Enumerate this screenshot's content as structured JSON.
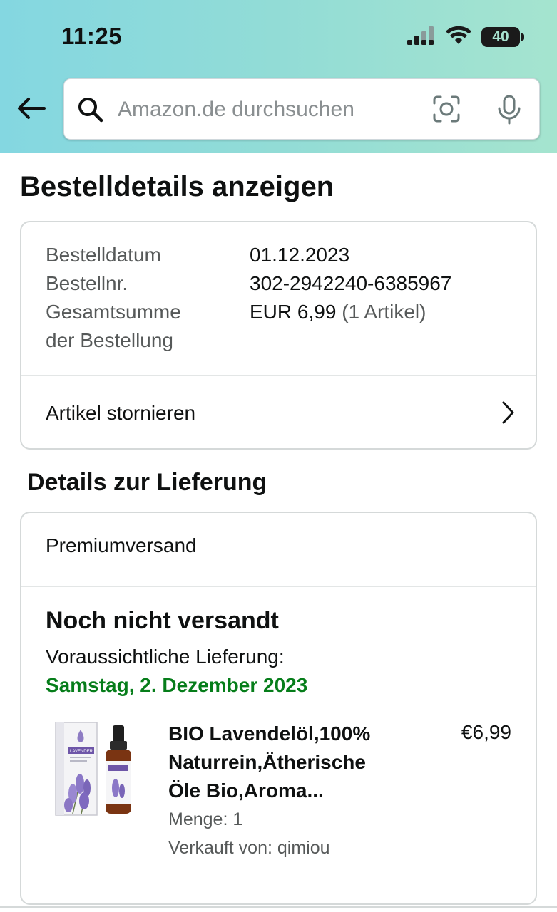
{
  "status_bar": {
    "time": "11:25",
    "battery": "40"
  },
  "search": {
    "placeholder": "Amazon.de durchsuchen"
  },
  "icons": {
    "back": "arrow-left-icon",
    "search": "magnifier-icon",
    "camera": "camera-scan-icon",
    "mic": "microphone-icon",
    "chevron": "chevron-right-icon"
  },
  "page": {
    "title": "Bestelldetails anzeigen"
  },
  "order": {
    "date_label": "Bestelldatum",
    "date_value": "01.12.2023",
    "number_label": "Bestellnr.",
    "number_value": "302-2942240-6385967",
    "total_label_line1": "Gesamtsumme",
    "total_label_line2": "der Bestellung",
    "total_value": "EUR 6,99",
    "total_count": "(1 Artikel)",
    "cancel_label": "Artikel stornieren"
  },
  "delivery": {
    "section_title": "Details zur Lieferung",
    "shipping_method": "Premiumversand",
    "status": "Noch nicht versandt",
    "expected_label": "Voraussichtliche Lieferung:",
    "expected_date": "Samstag, 2. Dezember 2023"
  },
  "product": {
    "title_line1": "BIO Lavendelöl,100%",
    "title_line2": "Naturrein,Ätherische",
    "title_line3": "Öle Bio,Aroma...",
    "price": "€6,99",
    "quantity": "Menge: 1",
    "seller": "Verkauft von: qimiou",
    "image_box_label": "LAVENDER"
  },
  "colors": {
    "header_gradient_start": "#84d7e1",
    "header_gradient_end": "#a5e4cf",
    "delivery_date_green": "#067d1a",
    "secondary_text": "#565959",
    "card_border": "#d5d9d9"
  }
}
